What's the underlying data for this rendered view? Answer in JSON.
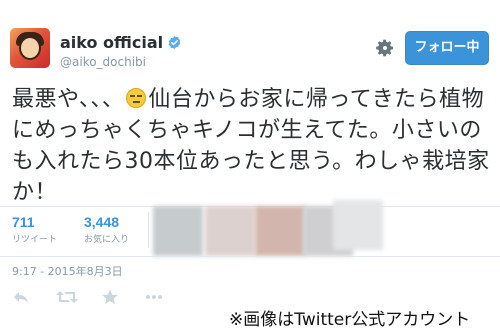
{
  "user": {
    "display_name": "aiko official",
    "handle": "@aiko_dochibi"
  },
  "follow_button": {
    "label": "フォロー中"
  },
  "tweet": {
    "text_part1": "最悪や、、、",
    "text_part2": "仙台からお家に帰ってきたら植物にめっちゃくちゃキノコが生えてた。小さいのも入れたら30本位あったと思う。わしゃ栽培家か！",
    "emoji_name": "expressionless-face"
  },
  "stats": {
    "retweets": {
      "count": "711",
      "label": "リツイート"
    },
    "favorites": {
      "count": "3,448",
      "label": "お気に入り"
    }
  },
  "timestamp": "9:17 - 2015年8月3日",
  "caption": "※画像はTwitter公式アカウント",
  "icons": {
    "gear": "gear-icon",
    "verified": "verified-badge-icon",
    "reply": "reply-icon",
    "retweet": "retweet-icon",
    "favorite": "star-icon",
    "more": "more-icon"
  },
  "colors": {
    "accent": "#3b94d9",
    "muted": "#8899a6",
    "text": "#292f33"
  },
  "favoriter_avatar_colors": [
    "#c6cbce",
    "#ddd1cf",
    "#d2b6ad",
    "#cfcfd1",
    "#e4e5e7"
  ]
}
